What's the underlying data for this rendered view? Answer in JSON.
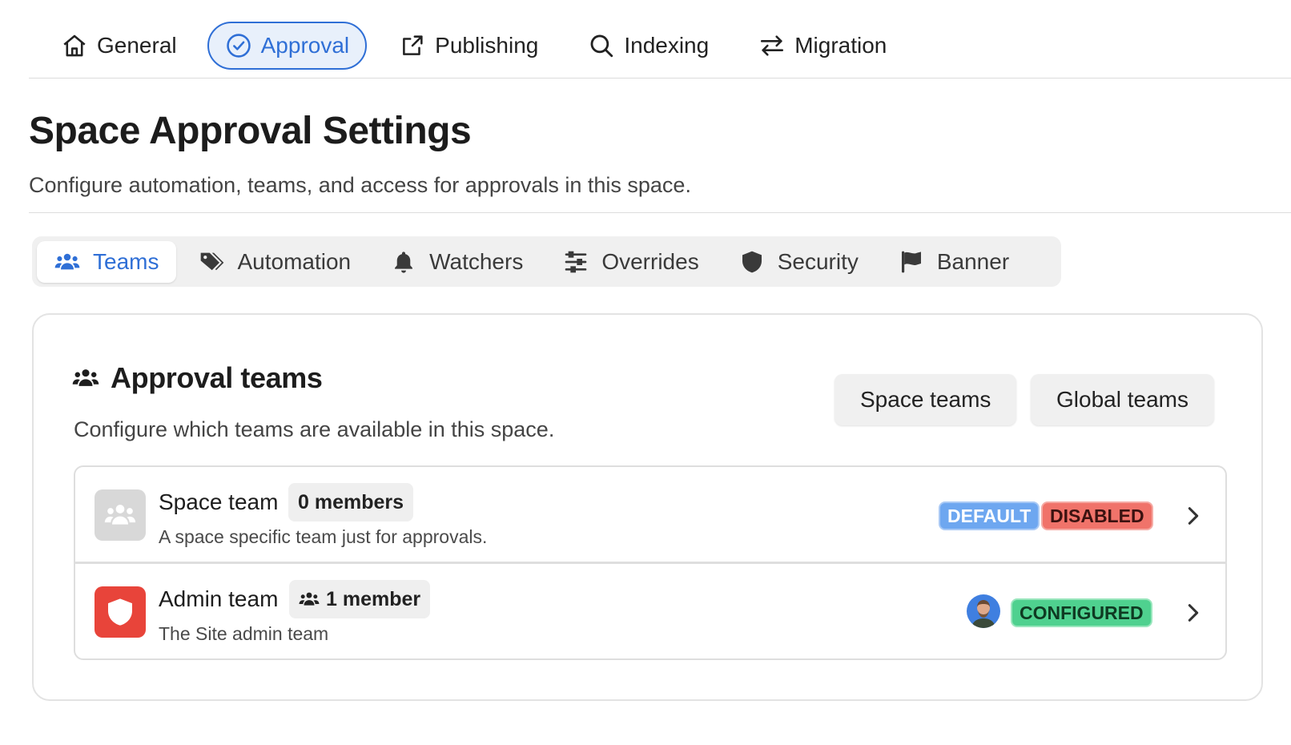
{
  "topnav": {
    "items": [
      {
        "label": "General",
        "icon": "home-icon",
        "active": false
      },
      {
        "label": "Approval",
        "icon": "check-circle-icon",
        "active": true
      },
      {
        "label": "Publishing",
        "icon": "share-icon",
        "active": false
      },
      {
        "label": "Indexing",
        "icon": "search-icon",
        "active": false
      },
      {
        "label": "Migration",
        "icon": "arrows-swap-icon",
        "active": false
      }
    ]
  },
  "page": {
    "title": "Space Approval Settings",
    "subtitle": "Configure automation, teams, and access for approvals in this space."
  },
  "subtabs": {
    "items": [
      {
        "label": "Teams",
        "icon": "users-icon",
        "active": true
      },
      {
        "label": "Automation",
        "icon": "tags-icon",
        "active": false
      },
      {
        "label": "Watchers",
        "icon": "bell-icon",
        "active": false
      },
      {
        "label": "Overrides",
        "icon": "sliders-icon",
        "active": false
      },
      {
        "label": "Security",
        "icon": "shield-icon",
        "active": false
      },
      {
        "label": "Banner",
        "icon": "flag-icon",
        "active": false
      }
    ]
  },
  "card": {
    "title": "Approval teams",
    "subtitle": "Configure which teams are available in this space.",
    "buttons": {
      "space_teams": "Space teams",
      "global_teams": "Global teams"
    },
    "teams": [
      {
        "name": "Space team",
        "members": "0 members",
        "description": "A space specific team just for approvals.",
        "badges": [
          "DEFAULT",
          "DISABLED"
        ]
      },
      {
        "name": "Admin team",
        "members": "1 member",
        "description": "The Site admin team",
        "badges": [
          "CONFIGURED"
        ]
      }
    ]
  },
  "colors": {
    "accent": "#2f6fd6",
    "default_badge": "#6ea7f0",
    "disabled_badge": "#f0736a",
    "configured_badge": "#4fd18f",
    "admin_team": "#e8443a"
  }
}
